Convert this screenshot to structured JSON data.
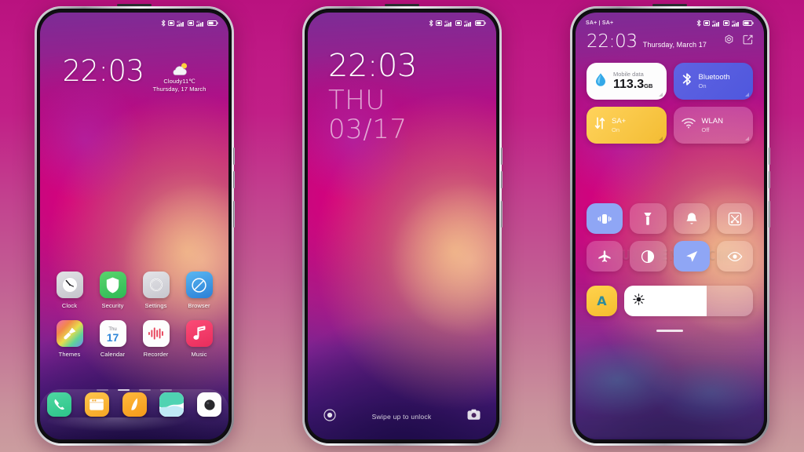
{
  "wallpaper": {
    "top_color": "#7c2c96",
    "mid_color": "#c3107f",
    "warm_color": "#e8aa78",
    "bottom_color": "#1d0f4e"
  },
  "background_gradient": {
    "from": "#b9127f",
    "to": "#cb9d9f"
  },
  "phone1": {
    "name": "home-screen",
    "statusbar": {
      "left": "",
      "icons": [
        "bluetooth-icon",
        "sim1-icon",
        "signal-4g-icon",
        "sim2-icon",
        "signal-4g-icon",
        "battery-icon"
      ]
    },
    "clock": "22:03",
    "weather": {
      "icon": "cloudy-sun-icon",
      "condition": "Cloudy11℃",
      "date": "Thursday, 17 March"
    },
    "apps": [
      {
        "label": "Clock",
        "icon": "clock-app-icon"
      },
      {
        "label": "Security",
        "icon": "security-shield-icon"
      },
      {
        "label": "Settings",
        "icon": "settings-gear-icon"
      },
      {
        "label": "Browser",
        "icon": "browser-compass-icon"
      },
      {
        "label": "Themes",
        "icon": "themes-brush-icon"
      },
      {
        "label": "Calendar",
        "icon": "calendar-icon",
        "day_name": "Thu",
        "day_num": "17"
      },
      {
        "label": "Recorder",
        "icon": "recorder-wave-icon"
      },
      {
        "label": "Music",
        "icon": "music-note-icon"
      }
    ],
    "page_dots": {
      "count": 4,
      "active": 1
    },
    "dock": [
      {
        "name": "phone-app",
        "icon": "phone-handset-icon"
      },
      {
        "name": "messages-app",
        "icon": "messages-icon"
      },
      {
        "name": "notes-app",
        "icon": "notes-feather-icon"
      },
      {
        "name": "gallery-app",
        "icon": "gallery-icon"
      },
      {
        "name": "camera-app",
        "icon": "camera-lens-icon"
      }
    ]
  },
  "phone2": {
    "name": "lock-screen",
    "statusbar": {
      "icons": [
        "bluetooth-icon",
        "sim1-icon",
        "signal-4g-icon",
        "sim2-icon",
        "signal-4g-icon",
        "battery-icon"
      ]
    },
    "time": "22:03",
    "day_of_week": "THU",
    "date": "03/17",
    "unlock_hint": "Swipe up to unlock",
    "left_icon": "torch-icon",
    "right_icon": "camera-icon"
  },
  "phone3": {
    "name": "control-center",
    "statusbar": {
      "left": "SA+ | SA+",
      "icons": [
        "bluetooth-icon",
        "sim1-icon",
        "signal-4g-icon",
        "sim2-icon",
        "signal-4g-icon",
        "battery-icon"
      ]
    },
    "time": "22:03",
    "date": "Thursday, March 17",
    "header_icons": [
      "settings-gear-icon",
      "edit-icon"
    ],
    "cards": [
      {
        "title": "Mobile data",
        "value": "113.3",
        "unit": "GB",
        "sub": "",
        "icon": "data-drop-icon",
        "style": "white",
        "color": "#ffffff"
      },
      {
        "title": "Bluetooth",
        "value": "",
        "unit": "",
        "sub": "On",
        "icon": "bluetooth-icon",
        "style": "blue",
        "color": "#5c62e0"
      },
      {
        "title": "SA+",
        "value": "",
        "unit": "",
        "sub": "On",
        "icon": "data-arrows-icon",
        "style": "amber",
        "color": "#f5c13d"
      },
      {
        "title": "WLAN",
        "value": "",
        "unit": "",
        "sub": "Off",
        "icon": "wifi-icon",
        "style": "ghost",
        "color": "rgba(255,255,255,0.22)"
      }
    ],
    "toggles": [
      {
        "name": "vibrate-toggle",
        "icon": "vibrate-icon",
        "active": true
      },
      {
        "name": "flashlight-toggle",
        "icon": "flashlight-icon",
        "active": false
      },
      {
        "name": "ringer-toggle",
        "icon": "bell-icon",
        "active": false
      },
      {
        "name": "screenshot-toggle",
        "icon": "scissors-icon",
        "active": false
      },
      {
        "name": "airplane-toggle",
        "icon": "airplane-icon",
        "active": false
      },
      {
        "name": "darkmode-toggle",
        "icon": "contrast-icon",
        "active": false
      },
      {
        "name": "location-toggle",
        "icon": "location-arrow-icon",
        "active": true
      },
      {
        "name": "readingmode-toggle",
        "icon": "eye-icon",
        "active": false
      }
    ],
    "auto_brightness_label": "A",
    "brightness_percent": 64,
    "brightness_icon": "sun-icon"
  },
  "watermark": "MIUITHEMER.COM"
}
